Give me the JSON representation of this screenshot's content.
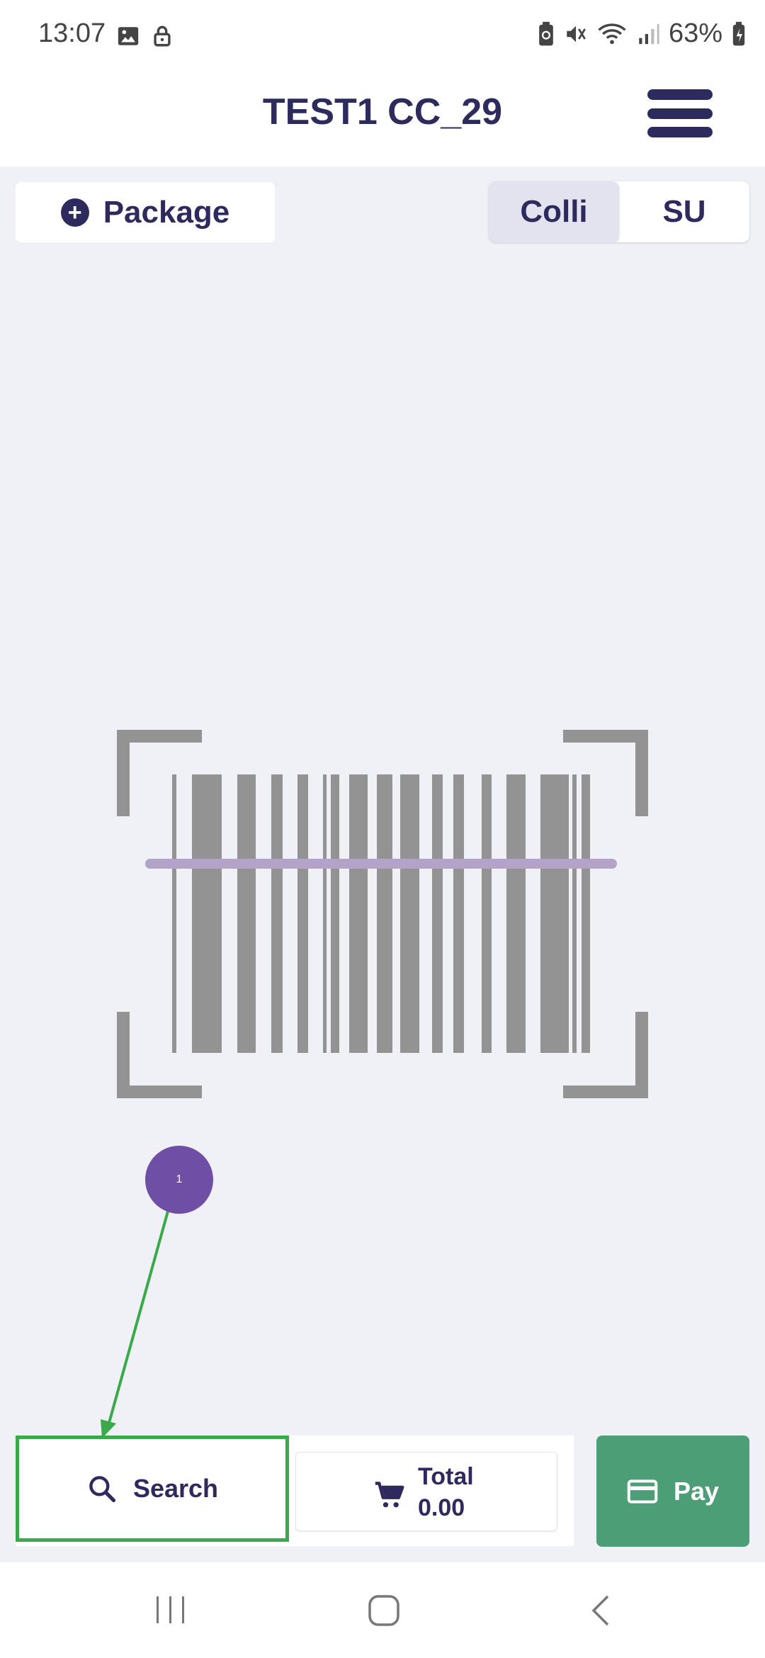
{
  "status_bar": {
    "time": "13:07",
    "battery": "63%"
  },
  "header": {
    "title": "TEST1 CC_29"
  },
  "package_button": {
    "label": "Package"
  },
  "mode_toggle": {
    "options": [
      "Colli",
      "SU"
    ],
    "selected": "Colli"
  },
  "annotation": {
    "marker_label": "1"
  },
  "bottom_bar": {
    "search_label": "Search",
    "total_label": "Total",
    "total_value": "0.00",
    "pay_label": "Pay"
  },
  "colors": {
    "primary": "#2d2b5e",
    "background": "#f0f1f7",
    "pay": "#4b9e76",
    "scan_line": "#b4a3c8",
    "marker": "#6f4fa6",
    "highlight": "#3aa94a"
  },
  "icons": [
    "image-icon",
    "lock-icon",
    "battery-saver-icon",
    "mute-icon",
    "wifi-icon",
    "signal-icon",
    "battery-icon",
    "menu-icon",
    "add-circle-icon",
    "barcode-scanner-icon",
    "search-icon",
    "cart-icon",
    "card-icon",
    "recents-icon",
    "home-icon",
    "back-icon"
  ]
}
